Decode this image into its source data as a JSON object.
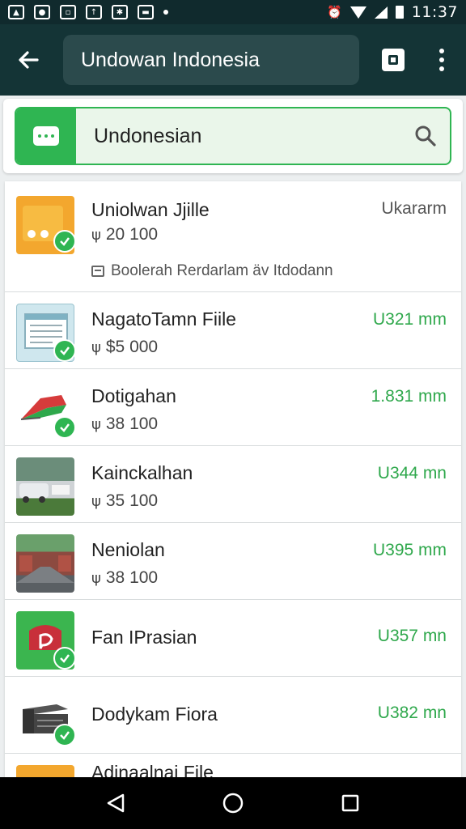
{
  "status_bar": {
    "time": "11:37",
    "left_icons": [
      "gallery-icon",
      "photo-icon",
      "file-icon",
      "upload-icon",
      "settings-icon",
      "battery-saver-icon"
    ],
    "right_icons": [
      "alarm-icon",
      "wifi-icon",
      "signal-icon",
      "battery-icon"
    ]
  },
  "app_bar": {
    "title": "Undowan Indonesia",
    "back_icon": "back-arrow-icon",
    "action_icon": "window-icon",
    "menu_icon": "more-vert-icon"
  },
  "search": {
    "value": "Undonesian",
    "leading_icon": "chat-icon",
    "trailing_icon": "search-icon"
  },
  "items": [
    {
      "name": "Uniolwan Jjille",
      "sub": "20 100",
      "meta": "Ukararm",
      "note": "Boolerah Rerdarlam äv Itdodann",
      "thumb": "folder"
    },
    {
      "name": "NagatoTamn Fiile",
      "sub": "$5 000",
      "meta": "U321 mm",
      "thumb": "spreadsheet"
    },
    {
      "name": "Dotigahan",
      "sub": "38 100",
      "meta": "1.831 mm",
      "thumb": "flag"
    },
    {
      "name": "Kainckalhan",
      "sub": "35 100",
      "meta": "U344 mn",
      "thumb": "photo-street"
    },
    {
      "name": "Neniolan",
      "sub": "38 100",
      "meta": "U395 mm",
      "thumb": "photo-buildings"
    },
    {
      "name": "Fan IPrasian",
      "meta": "U357 mn",
      "thumb": "chat"
    },
    {
      "name": "Dodykam Fiora",
      "meta": "U382 mn",
      "thumb": "server"
    },
    {
      "name": "Adinaalnai File",
      "thumb": "folder"
    }
  ],
  "sub_symbol": "ψ",
  "colors": {
    "app_bar": "#143436",
    "status_bar": "#102a2d",
    "accent_green": "#2fb552",
    "background": "#eceff0"
  }
}
